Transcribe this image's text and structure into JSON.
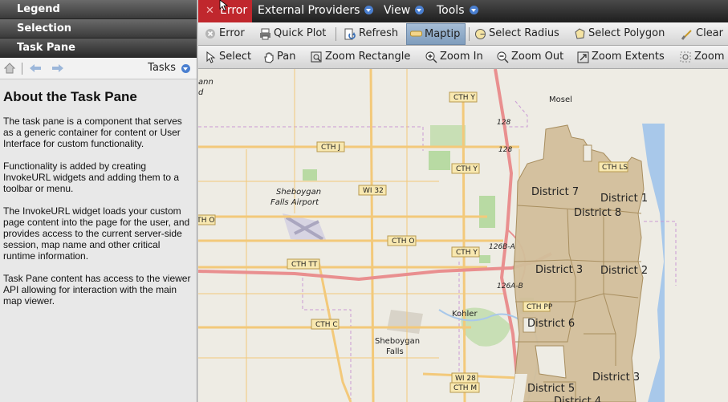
{
  "accordion": {
    "legend": "Legend",
    "selection": "Selection",
    "task_pane": "Task Pane"
  },
  "task_toolbar": {
    "tasks_label": "Tasks"
  },
  "task_content": {
    "title": "About the Task Pane",
    "paragraphs": [
      "The task pane is a component that serves as a generic container for content or User Interface for custom functionality.",
      "Functionality is added by creating InvokeURL widgets and adding them to a toolbar or menu.",
      "The InvokeURL widget loads your custom page content into the page for the user, and provides access to the current server-side session, map name and other critical runtime information.",
      "Task Pane content has access to the viewer API allowing for interaction with the main map viewer."
    ]
  },
  "menubar": {
    "error": "Error",
    "external_providers": "External Providers",
    "view": "View",
    "tools": "Tools"
  },
  "toolbar1": {
    "error": "Error",
    "quick_plot": "Quick Plot",
    "refresh": "Refresh",
    "maptip": "Maptip",
    "select_radius": "Select Radius",
    "select_polygon": "Select Polygon",
    "clear": "Clear"
  },
  "toolbar2": {
    "select": "Select",
    "pan": "Pan",
    "zoom_rectangle": "Zoom Rectangle",
    "zoom_in": "Zoom In",
    "zoom_out": "Zoom Out",
    "zoom_extents": "Zoom Extents",
    "zoom": "Zoom"
  },
  "map": {
    "road_labels": {
      "cth_y_top": "CTH Y",
      "cth_j": "CTH J",
      "cth_y_mid": "CTH Y",
      "wi_32": "WI 32",
      "cth_o_left": "CTH O",
      "cth_o": "CTH O",
      "cth_tt": "CTH TT",
      "cth_y_low": "CTH Y",
      "cth_c": "CTH C",
      "wi_28": "WI 28",
      "cth_m": "CTH M",
      "r128a": "128",
      "r128b": "128",
      "r126ba": "126B-A",
      "r126ab": "126A-B",
      "cth_ls": "CTH LS",
      "cth_pp": "CTH PP"
    },
    "places": {
      "mosel": "Mosel",
      "airport1": "Sheboygan",
      "airport2": "Falls Airport",
      "kohler": "Kohler",
      "falls1": "Sheboygan",
      "falls2": "Falls",
      "corner1": "ann",
      "corner2": "d"
    },
    "districts": {
      "d7": "District 7",
      "d1": "District 1",
      "d8": "District 8",
      "d3a": "District 3",
      "d2": "District 2",
      "d6": "District 6",
      "d3b": "District 3",
      "d5": "District 5",
      "d4": "District 4"
    },
    "colors": {
      "district_fill": "#d2bf9b",
      "lake": "#a8c8ea",
      "highway": "#e98f8f",
      "road": "#f3c97a"
    }
  }
}
